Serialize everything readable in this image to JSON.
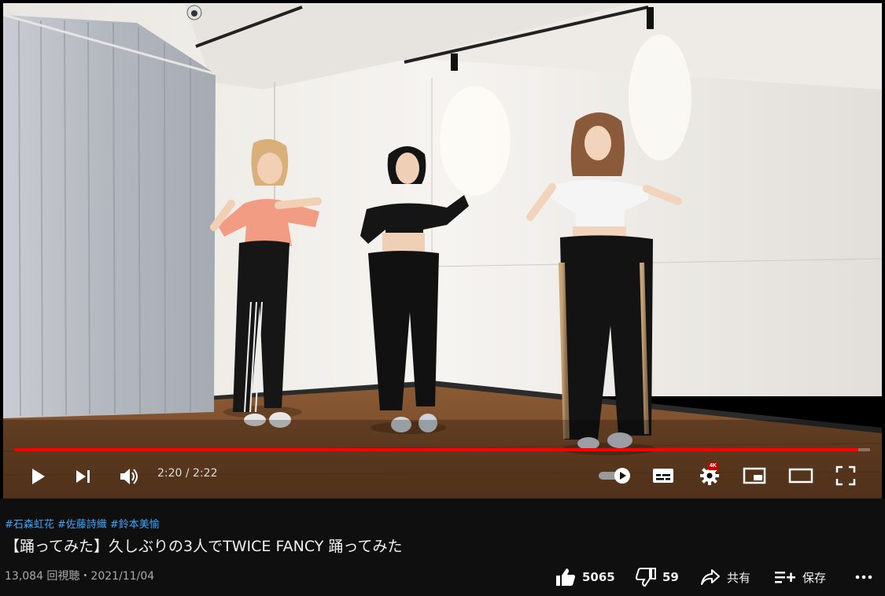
{
  "player": {
    "time_display": "2:20 / 2:22",
    "progress_fraction": 0.986,
    "quality_badge": "4K",
    "accent_color": "#ff0000"
  },
  "video": {
    "hashtags": [
      "#石森虹花",
      "#佐藤詩織",
      "#鈴本美愉"
    ],
    "title": "【踊ってみた】久しぶりの3人でTWICE FANCY 踊ってみた",
    "meta": "13,084 回視聴・2021/11/04"
  },
  "actions": {
    "like_count": "5065",
    "dislike_count": "59",
    "share_label": "共有",
    "save_label": "保存"
  },
  "icons": [
    "play-icon",
    "next-icon",
    "volume-icon",
    "autoplay-toggle-icon",
    "subtitles-icon",
    "settings-icon",
    "miniplayer-icon",
    "theater-icon",
    "fullscreen-icon",
    "thumbs-up-icon",
    "thumbs-down-icon",
    "share-icon",
    "save-icon",
    "more-icon"
  ]
}
